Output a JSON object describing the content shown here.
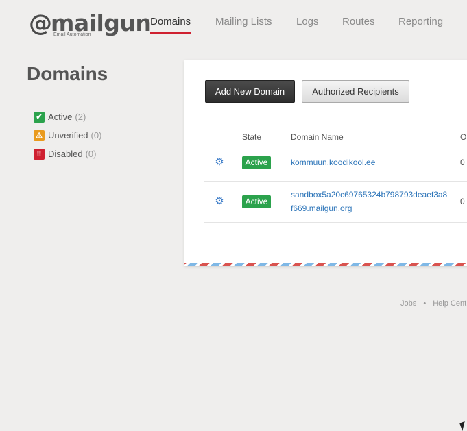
{
  "brand": {
    "at": "@",
    "name": "mailgun",
    "tagline": "Email Automation"
  },
  "nav": {
    "items": [
      {
        "label": "Domains",
        "active": true
      },
      {
        "label": "Mailing Lists"
      },
      {
        "label": "Logs"
      },
      {
        "label": "Routes"
      },
      {
        "label": "Reporting"
      }
    ]
  },
  "page": {
    "title": "Domains"
  },
  "filters": [
    {
      "label": "Active",
      "count": "(2)",
      "icon": "check-icon",
      "color": "#2ba24c",
      "glyph": "✔"
    },
    {
      "label": "Unverified",
      "count": "(0)",
      "icon": "warning-icon",
      "color": "#e99a1d",
      "glyph": "!"
    },
    {
      "label": "Disabled",
      "count": "(0)",
      "icon": "exclamation-icon",
      "color": "#cf2030",
      "glyph": "!!"
    }
  ],
  "toolbar": {
    "add_label": "Add New Domain",
    "recipients_label": "Authorized Recipients"
  },
  "table": {
    "headers": {
      "state": "State",
      "domain": "Domain Name",
      "other": "Ou"
    },
    "rows": [
      {
        "state": "Active",
        "domain": "kommuun.koodikool.ee",
        "value": "0"
      },
      {
        "state": "Active",
        "domain": "sandbox5a20c69765324b798793deaef3a8f669.mailgun.org",
        "value": "0"
      }
    ]
  },
  "footer": {
    "jobs": "Jobs",
    "sep": "•",
    "help": "Help Cent"
  },
  "colors": {
    "accent": "#cf2030",
    "active": "#2ba24c",
    "link": "#2a73b8"
  }
}
